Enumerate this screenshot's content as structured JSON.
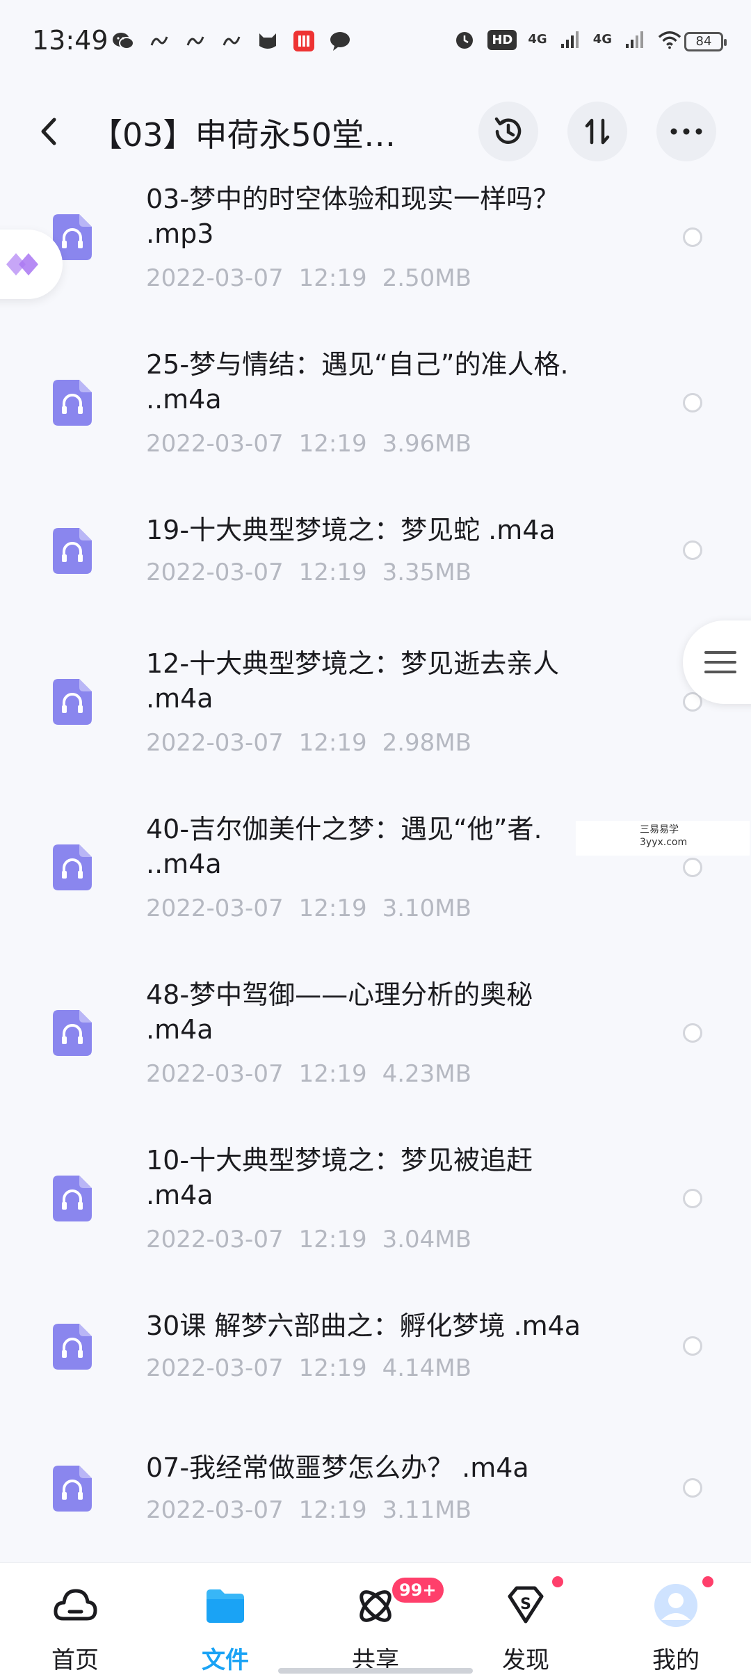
{
  "status_bar": {
    "time": "13:49",
    "hd_label": "HD",
    "network_1": "4G",
    "network_2": "4G",
    "battery": "84"
  },
  "header": {
    "title": "【03】申荷永50堂…"
  },
  "files": [
    {
      "name": "03-梦中的时空体验和现实一样吗？ .mp3",
      "date": "2022-03-07",
      "time": "12:19",
      "size": "2.50MB"
    },
    {
      "name": "25-梦与情结：遇见“自己”的准人格. ..m4a",
      "date": "2022-03-07",
      "time": "12:19",
      "size": "3.96MB"
    },
    {
      "name": "19-十大典型梦境之：梦见蛇 .m4a",
      "date": "2022-03-07",
      "time": "12:19",
      "size": "3.35MB"
    },
    {
      "name": "12-十大典型梦境之：梦见逝去亲人 .m4a",
      "date": "2022-03-07",
      "time": "12:19",
      "size": "2.98MB"
    },
    {
      "name": "40-吉尔伽美什之梦：遇见“他”者. ..m4a",
      "date": "2022-03-07",
      "time": "12:19",
      "size": "3.10MB"
    },
    {
      "name": "48-梦中驾御——心理分析的奥秘 .m4a",
      "date": "2022-03-07",
      "time": "12:19",
      "size": "4.23MB"
    },
    {
      "name": "10-十大典型梦境之：梦见被追赶 .m4a",
      "date": "2022-03-07",
      "time": "12:19",
      "size": "3.04MB"
    },
    {
      "name": "30课 解梦六部曲之：孵化梦境 .m4a",
      "date": "2022-03-07",
      "time": "12:19",
      "size": "4.14MB"
    },
    {
      "name": "07-我经常做噩梦怎么办？ .m4a",
      "date": "2022-03-07",
      "time": "12:19",
      "size": "3.11MB"
    }
  ],
  "watermark": {
    "line1": "三易易学",
    "line2": "3yyx.com"
  },
  "nav": {
    "home": "首页",
    "files": "文件",
    "share": "共享",
    "discover": "发现",
    "mine": "我的",
    "share_badge": "99+"
  },
  "colors": {
    "accent": "#1aa3f5",
    "file_icon": "#8a86ee",
    "badge": "#ff3f6b",
    "meta_text": "#b5b8c1"
  }
}
